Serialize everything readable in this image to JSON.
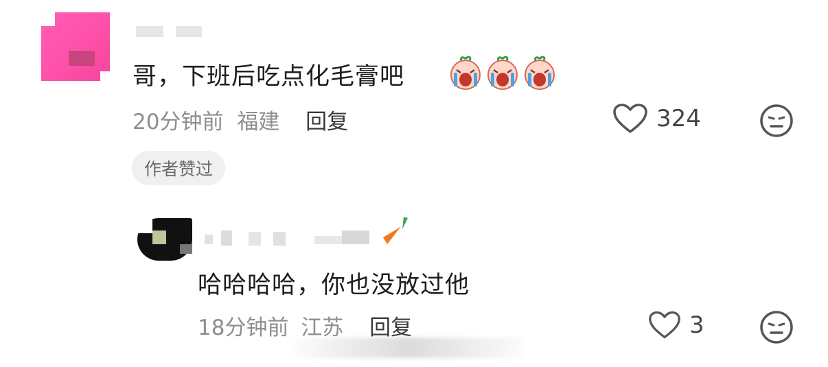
{
  "comment": {
    "text": "哥，下班后吃点化毛膏吧",
    "emojis": [
      "crying-peach-icon",
      "crying-peach-icon",
      "crying-peach-icon"
    ],
    "time": "20分钟前",
    "location": "福建",
    "reply_label": "回复",
    "like_count": "324",
    "author_badge": "作者赞过"
  },
  "reply": {
    "text": "哈哈哈哈，你也没放过他",
    "time": "18分钟前",
    "location": "江苏",
    "reply_label": "回复",
    "like_count": "3"
  },
  "colors": {
    "main_avatar": "#ff5db8",
    "badge_bg": "#f0f0f0",
    "meta_text": "#8e8e8e"
  }
}
